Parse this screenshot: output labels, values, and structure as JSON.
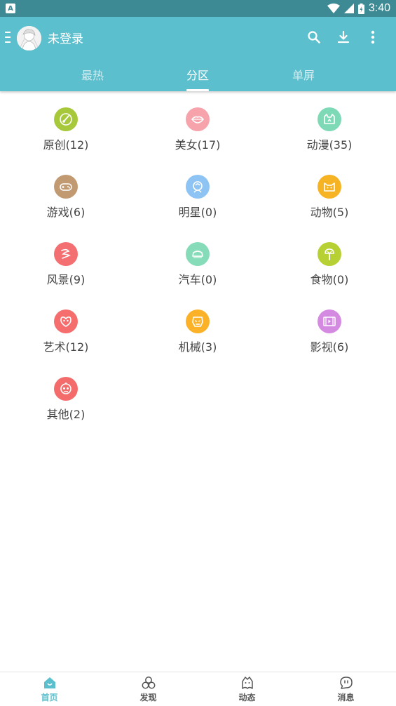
{
  "status_bar": {
    "left_icon": "A",
    "time": "3:40"
  },
  "header": {
    "user_name": "未登录",
    "icons": [
      "search-icon",
      "download-icon",
      "more-vertical-icon"
    ]
  },
  "tabs": [
    {
      "label": "最热",
      "active": false
    },
    {
      "label": "分区",
      "active": true
    },
    {
      "label": "单屏",
      "active": false
    }
  ],
  "categories": [
    {
      "label": "原创(12)",
      "icon": "brush-icon",
      "color": "#a6c83a"
    },
    {
      "label": "美女(17)",
      "icon": "lips-icon",
      "color": "#f6a3ac"
    },
    {
      "label": "动漫(35)",
      "icon": "anime-cat-icon",
      "color": "#7ed9b6"
    },
    {
      "label": "游戏(6)",
      "icon": "gamepad-icon",
      "color": "#c29a72"
    },
    {
      "label": "明星(0)",
      "icon": "star-face-icon",
      "color": "#8dc4f4"
    },
    {
      "label": "动物(5)",
      "icon": "cat-icon",
      "color": "#f6b324"
    },
    {
      "label": "风景(9)",
      "icon": "dragon-icon",
      "color": "#f46f71"
    },
    {
      "label": "汽车(0)",
      "icon": "car-icon",
      "color": "#86dcb8"
    },
    {
      "label": "食物(0)",
      "icon": "ice-cream-icon",
      "color": "#b7d033"
    },
    {
      "label": "艺术(12)",
      "icon": "art-mask-icon",
      "color": "#f66d6e"
    },
    {
      "label": "机械(3)",
      "icon": "robot-helmet-icon",
      "color": "#fbb228"
    },
    {
      "label": "影视(6)",
      "icon": "film-icon",
      "color": "#d48ae0"
    },
    {
      "label": "其他(2)",
      "icon": "other-robot-icon",
      "color": "#f46b6c"
    }
  ],
  "bottom_nav": [
    {
      "label": "首页",
      "icon": "home-icon",
      "active": true
    },
    {
      "label": "发现",
      "icon": "discover-icon",
      "active": false
    },
    {
      "label": "动态",
      "icon": "ghost-icon",
      "active": false
    },
    {
      "label": "消息",
      "icon": "message-icon",
      "active": false
    }
  ],
  "colors": {
    "primary": "#5bbfcd",
    "status_bar": "#3e8a94"
  }
}
